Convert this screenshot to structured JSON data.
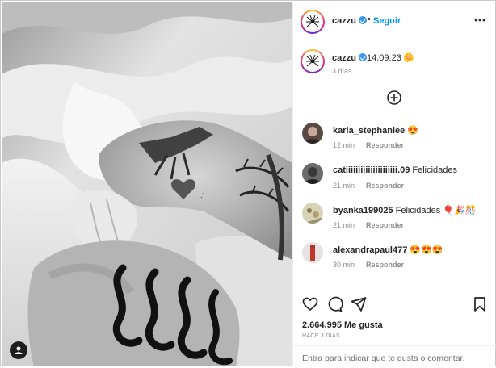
{
  "post": {
    "author": "cazzu",
    "follow_label": "Seguir",
    "separator": "•"
  },
  "caption": {
    "author": "cazzu",
    "date_text": "14.09.23",
    "sun_emoji": "🌼",
    "time_ago": "3 días"
  },
  "comments": [
    {
      "user": "karla_stephaniee",
      "text": "😍",
      "time": "12 min",
      "reply_label": "Responder"
    },
    {
      "user": "catiiiiiiiiiiiiiiiiiiiii.09",
      "text": "Felicidades",
      "time": "21 min",
      "reply_label": "Responder"
    },
    {
      "user": "byanka199025",
      "text": "Felicidades 🎈🎉🎊",
      "time": "21 min",
      "reply_label": "Responder"
    },
    {
      "user": "alexandrapaul477",
      "text": "😍😍😍",
      "time": "30 min",
      "reply_label": "Responder"
    }
  ],
  "actions": {
    "likes_text": "2.664.995 Me gusta",
    "post_date": "HACE 3 DÍAS",
    "add_comment_text": "Entra para indicar que te gusta o comentar."
  },
  "icons": [
    "verified-badge-icon",
    "more-options-icon",
    "plus-circle-icon",
    "heart-icon",
    "comment-icon",
    "share-icon",
    "bookmark-icon",
    "user-tag-icon"
  ],
  "colors": {
    "accent": "#0095f6",
    "verified": "#3897f0",
    "muted": "#8e8e8e"
  }
}
